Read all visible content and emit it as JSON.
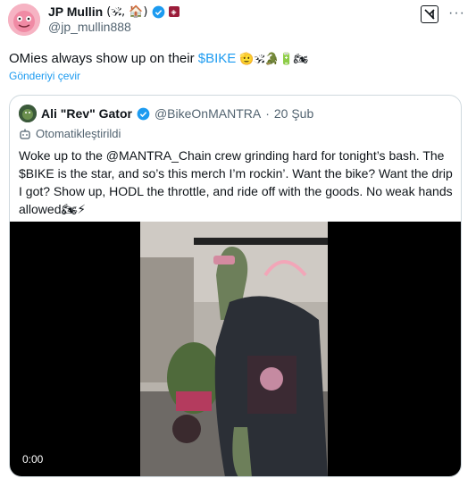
{
  "tweet": {
    "author": {
      "display_name": "JP Mullin",
      "name_emojis": "(🕉, 🏠)",
      "handle": "@jp_mullin888"
    },
    "text_prefix": "OMies always show up on their ",
    "cashtag": "$BIKE",
    "text_emojis": " 🫡🕉🐊🔋🏍",
    "translate_link": "Gönderiyi çevir"
  },
  "quoted_tweet": {
    "author": {
      "display_name": "Ali \"Rev\" Gator",
      "handle": "@BikeOnMANTRA",
      "separator": "·",
      "date": "20 Şub"
    },
    "auto_label": "Otomatikleştirildi",
    "text": "Woke up to the @MANTRA_Chain crew grinding hard for tonight’s bash. The $BIKE is the star, and so’s this merch I’m rockin’. Want the bike? Want the drip I got? Show up, HODL the throttle, and ride off with the goods. No weak hands allowed🏍⚡",
    "video": {
      "timestamp": "0:00"
    }
  },
  "colors": {
    "link": "#1d9bf0",
    "verified": "#1d9bf0",
    "muted": "#536471",
    "border": "#cfd9de"
  }
}
